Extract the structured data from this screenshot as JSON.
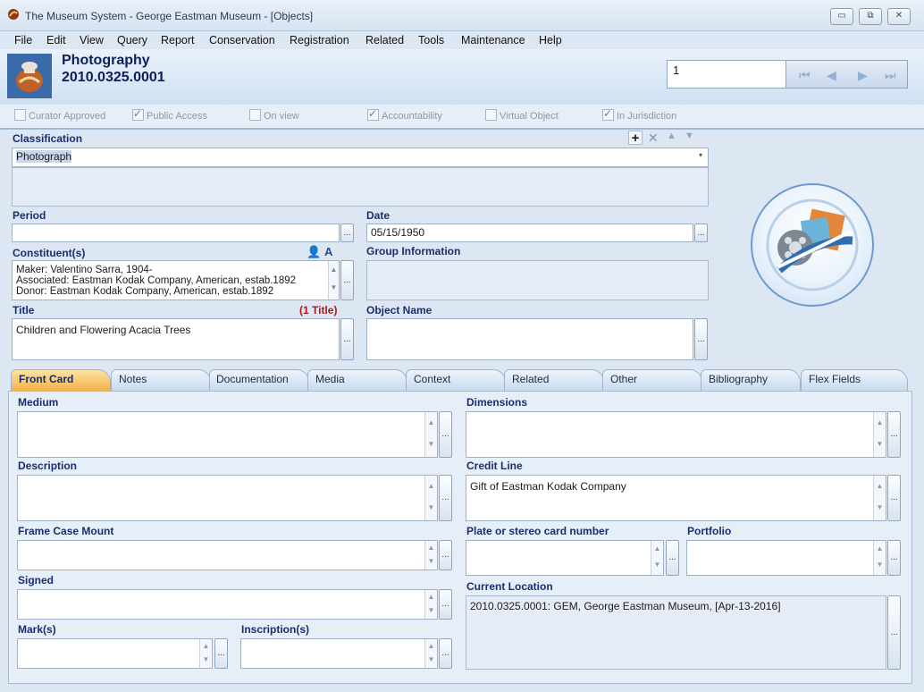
{
  "window": {
    "title": "The Museum System - George Eastman Museum - [Objects]"
  },
  "menu": [
    "File",
    "Edit",
    "View",
    "Query",
    "Report",
    "Conservation",
    "Registration",
    "Related",
    "Tools",
    "Maintenance",
    "Help"
  ],
  "header": {
    "classification": "Photography",
    "object_number": "2010.0325.0001",
    "record_number": "1"
  },
  "checkboxes": [
    {
      "label": "Curator Approved",
      "checked": false
    },
    {
      "label": "Public Access",
      "checked": true
    },
    {
      "label": "On view",
      "checked": false
    },
    {
      "label": "Accountability",
      "checked": true
    },
    {
      "label": "Virtual Object",
      "checked": false
    },
    {
      "label": "In Jurisdiction",
      "checked": true
    }
  ],
  "form": {
    "classification_label": "Classification",
    "classification_value": "Photograph",
    "period_label": "Period",
    "period_value": "",
    "date_label": "Date",
    "date_value": "05/15/1950",
    "constituents_label": "Constituent(s)",
    "constituents": [
      "Maker: Valentino Sarra, 1904-",
      "Associated: Eastman Kodak Company, American, estab.1892",
      "Donor: Eastman Kodak Company, American, estab.1892"
    ],
    "group_info_label": "Group Information",
    "title_label": "Title",
    "title_count": "(1 Title)",
    "title_value": "Children and Flowering Acacia Trees",
    "object_name_label": "Object Name",
    "object_name_value": ""
  },
  "tabs": [
    "Front Card",
    "Notes",
    "Documentation",
    "Media",
    "Context",
    "Related",
    "Other",
    "Bibliography",
    "Flex Fields"
  ],
  "active_tab": "Front Card",
  "front_card": {
    "medium_label": "Medium",
    "dimensions_label": "Dimensions",
    "description_label": "Description",
    "credit_line_label": "Credit Line",
    "credit_line_value": "Gift of Eastman Kodak Company",
    "frame_label": "Frame Case Mount",
    "plate_label": "Plate or stereo card number",
    "portfolio_label": "Portfolio",
    "signed_label": "Signed",
    "current_location_label": "Current Location",
    "current_location_value": "2010.0325.0001: GEM, George Eastman Museum,   [Apr-13-2016]",
    "marks_label": "Mark(s)",
    "inscriptions_label": "Inscription(s)"
  },
  "colors": {
    "active_tab": "#f4b246",
    "label_blue": "#1c2d70",
    "title_count_red": "#b01818"
  }
}
